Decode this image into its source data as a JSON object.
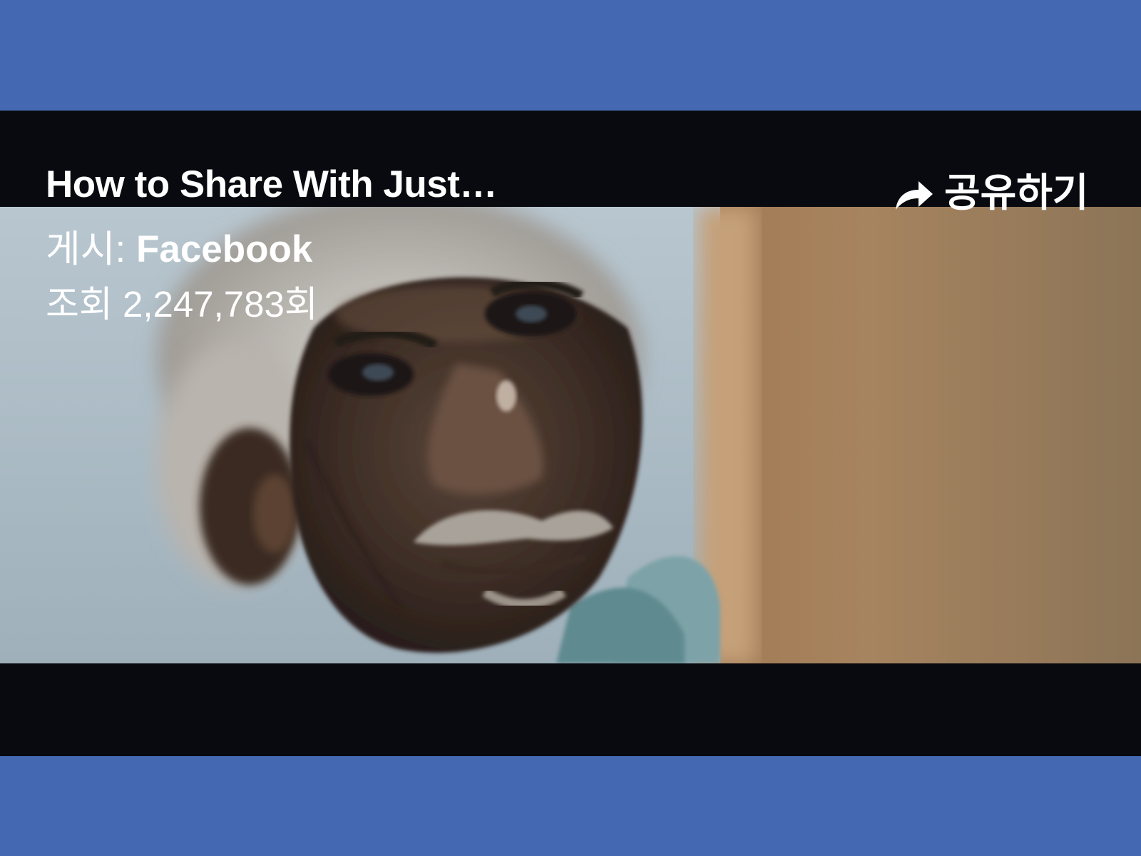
{
  "video": {
    "title": "How to Share With Just…",
    "posted_prefix": "게시: ",
    "page_name": "Facebook",
    "views_text": "조회 2,247,783회",
    "share_label": "공유하기",
    "share_icon": "share-arrow-icon"
  },
  "colors": {
    "background_band": "#4469b2",
    "player_background": "#090a0f",
    "text": "#ffffff"
  }
}
